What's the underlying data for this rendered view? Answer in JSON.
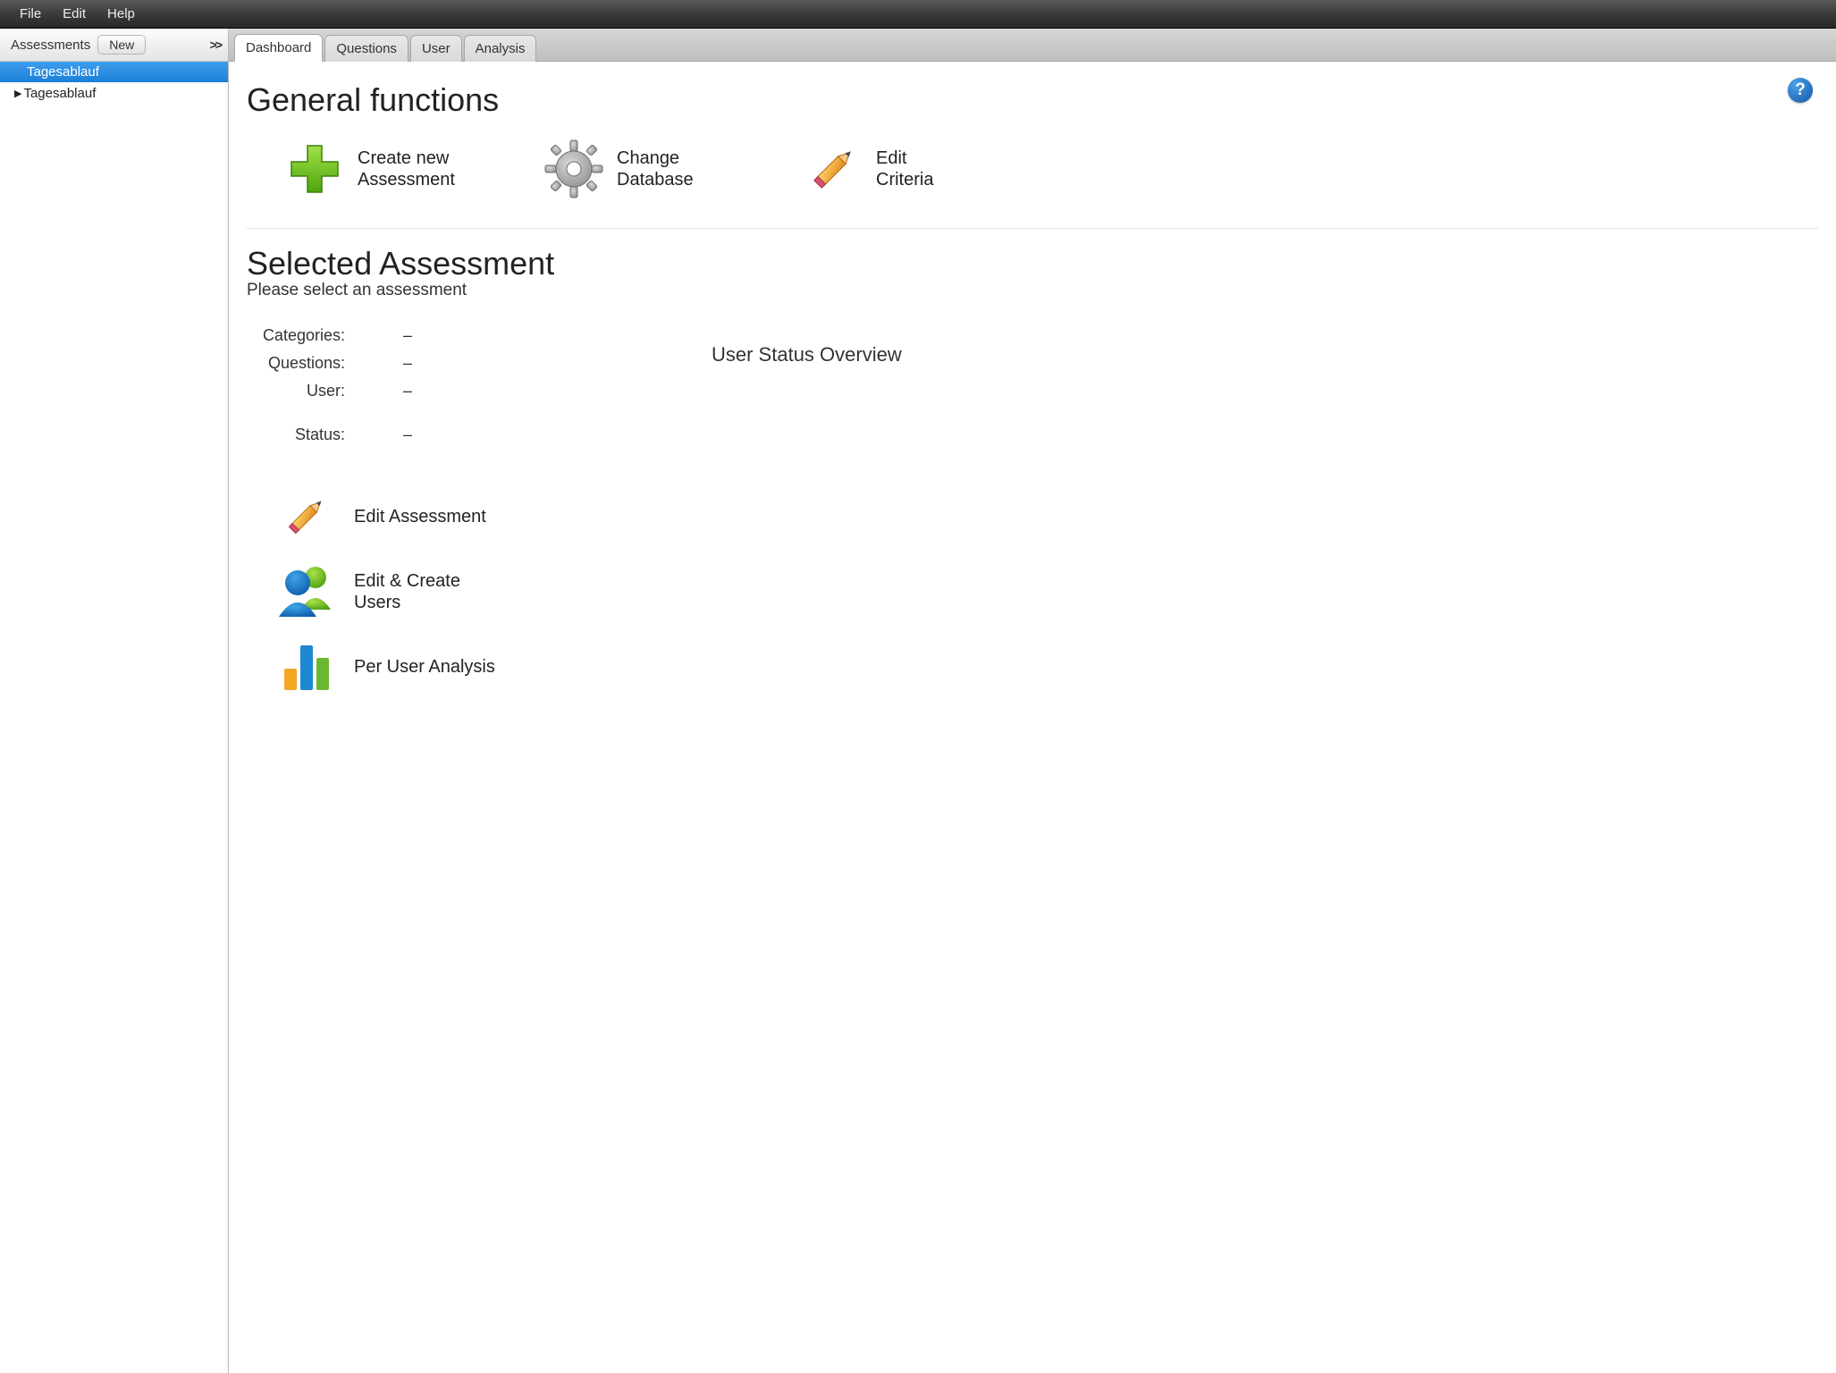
{
  "menubar": {
    "file": "File",
    "edit": "Edit",
    "help": "Help"
  },
  "sidebar": {
    "title": "Assessments",
    "new_button": "New",
    "collapse_glyph": ">>",
    "selected_item": "Tagesablauf",
    "tree_item": "Tagesablauf"
  },
  "tabs": [
    {
      "label": "Dashboard",
      "active": true
    },
    {
      "label": "Questions",
      "active": false
    },
    {
      "label": "User",
      "active": false
    },
    {
      "label": "Analysis",
      "active": false
    }
  ],
  "help_glyph": "?",
  "general_functions": {
    "heading": "General functions",
    "items": [
      {
        "line1": "Create new",
        "line2": "Assessment"
      },
      {
        "line1": "Change",
        "line2": "Database"
      },
      {
        "line1": "Edit",
        "line2": "Criteria"
      }
    ]
  },
  "selected_assessment": {
    "heading": "Selected Assessment",
    "subheading": "Please select an assessment",
    "stats": {
      "categories_label": "Categories:",
      "categories_value": "–",
      "questions_label": "Questions:",
      "questions_value": "–",
      "user_label": "User:",
      "user_value": "–",
      "status_label": "Status:",
      "status_value": "–"
    },
    "overview_title": "User Status Overview",
    "actions": [
      {
        "label": "Edit Assessment"
      },
      {
        "line1": "Edit & Create",
        "line2": "Users"
      },
      {
        "label": "Per User Analysis"
      }
    ]
  }
}
